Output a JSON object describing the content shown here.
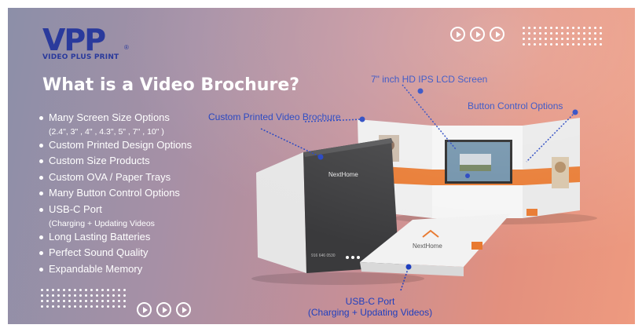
{
  "brand": {
    "logo_mark": "VPP",
    "logo_tagline": "VIDEO PLUS PRINT",
    "logo_reg": "®"
  },
  "headline": "What is a Video Brochure?",
  "features": [
    {
      "text": "Many Screen Size Options",
      "sub": "(2.4\", 3\" , 4\" , 4.3\", 5\" , 7\" , 10\" )"
    },
    {
      "text": "Custom Printed Design Options"
    },
    {
      "text": "Custom Size Products"
    },
    {
      "text": "Custom OVA / Paper Trays"
    },
    {
      "text": "Many Button Control Options"
    },
    {
      "text": "USB-C Port",
      "sub": "(Charging + Updating Videos"
    },
    {
      "text": "Long Lasting Batteries"
    },
    {
      "text": "Perfect Sound Quality"
    },
    {
      "text": "Expandable Memory"
    }
  ],
  "callouts": {
    "screen": "7\" inch HD IPS LCD Screen",
    "buttons": "Button Control Options",
    "custom_printed": "Custom Printed Video Brochure",
    "usb_line1": "USB-C Port",
    "usb_line2": "(Charging + Updating Videos)"
  },
  "brochure_print": {
    "brand": "NextHome",
    "phone": "916 646 0530"
  },
  "colors": {
    "brand_blue": "#2a3a9c",
    "callout_blue": "#1f3fbf",
    "accent_orange": "#e8782e",
    "brochure_dark": "#3a3a3c"
  }
}
